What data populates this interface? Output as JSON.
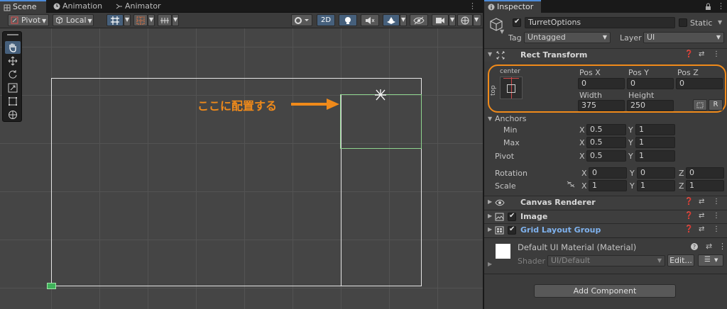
{
  "tabs": {
    "scene": "Scene",
    "animation": "Animation",
    "animator": "Animator",
    "inspector": "Inspector"
  },
  "toolbar": {
    "pivot": "Pivot",
    "local": "Local",
    "mode_2d": "2D"
  },
  "scene": {
    "annotation": "ここに配置する",
    "annotation_color": "#f08a1a"
  },
  "inspector": {
    "object_name": "TurretOptions",
    "static_label": "Static",
    "tag_label": "Tag",
    "tag_value": "Untagged",
    "layer_label": "Layer",
    "layer_value": "UI",
    "rect_transform": {
      "title": "Rect Transform",
      "anchor_h": "center",
      "anchor_v": "top",
      "pos_x_label": "Pos X",
      "pos_y_label": "Pos Y",
      "pos_z_label": "Pos Z",
      "pos_x": "0",
      "pos_y": "0",
      "pos_z": "0",
      "width_label": "Width",
      "height_label": "Height",
      "width": "375",
      "height": "250",
      "r_button": "R",
      "anchors_label": "Anchors",
      "min_label": "Min",
      "max_label": "Max",
      "min_x": "0.5",
      "min_y": "1",
      "max_x": "0.5",
      "max_y": "1",
      "pivot_label": "Pivot",
      "pivot_x": "0.5",
      "pivot_y": "1",
      "rotation_label": "Rotation",
      "rot_x": "0",
      "rot_y": "0",
      "rot_z": "0",
      "scale_label": "Scale",
      "scale_x": "1",
      "scale_y": "1",
      "scale_z": "1",
      "axis_x": "X",
      "axis_y": "Y",
      "axis_z": "Z"
    },
    "components": {
      "canvas_renderer": "Canvas Renderer",
      "image": "Image",
      "grid_layout_group": "Grid Layout Group"
    },
    "material": {
      "name": "Default UI Material (Material)",
      "shader_label": "Shader",
      "shader_value": "UI/Default",
      "edit_button": "Edit..."
    },
    "add_component": "Add Component"
  }
}
